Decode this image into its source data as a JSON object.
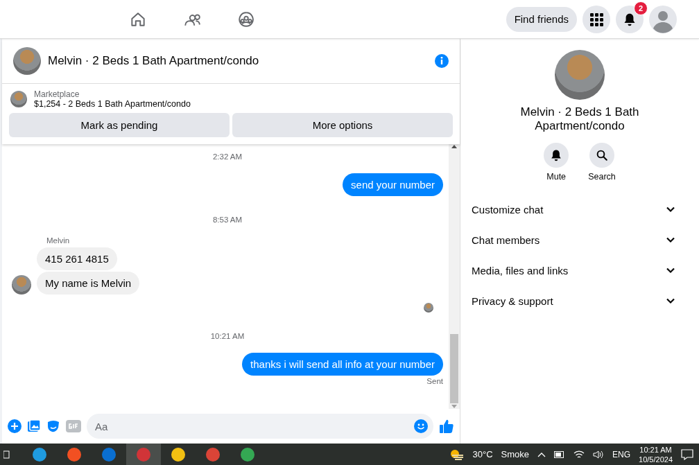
{
  "top_actions": {
    "find_friends": "Find friends",
    "notification_count": "2"
  },
  "chat_header": {
    "title": "Melvin · 2 Beds 1 Bath Apartment/condo"
  },
  "listing": {
    "source": "Marketplace",
    "summary": "$1,254 - 2 Beds 1 Bath Apartment/condo",
    "buttons": [
      "Mark as pending",
      "More options"
    ]
  },
  "messages": [
    {
      "kind": "time",
      "text": "2:32 AM"
    },
    {
      "kind": "outgoing",
      "text": "send your number"
    },
    {
      "kind": "time",
      "text": "8:53 AM"
    },
    {
      "kind": "sender",
      "text": "Melvin"
    },
    {
      "kind": "incoming",
      "text": "415 261 4815",
      "avatar": false
    },
    {
      "kind": "incoming",
      "text": "My name is Melvin",
      "avatar": true
    },
    {
      "kind": "seen"
    },
    {
      "kind": "time",
      "text": "10:21 AM"
    },
    {
      "kind": "outgoing",
      "text": "thanks i will send all info at your number"
    },
    {
      "kind": "status",
      "text": "Sent"
    }
  ],
  "composer": {
    "placeholder": "Aa"
  },
  "details": {
    "title": "Melvin · 2 Beds 1 Bath Apartment/condo",
    "actions": [
      {
        "kind": "mute",
        "label": "Mute"
      },
      {
        "kind": "search",
        "label": "Search"
      }
    ],
    "sections": [
      {
        "label": "Customize chat",
        "expanded": false
      },
      {
        "label": "Chat members",
        "expanded": false
      },
      {
        "label": "Media, files and links",
        "expanded": false
      },
      {
        "label": "Privacy & support",
        "expanded": false
      }
    ]
  },
  "taskbar": {
    "temperature": "30°C",
    "condition": "Smoke",
    "language": "ENG",
    "time": "10:21 AM",
    "date": "10/5/2024"
  }
}
